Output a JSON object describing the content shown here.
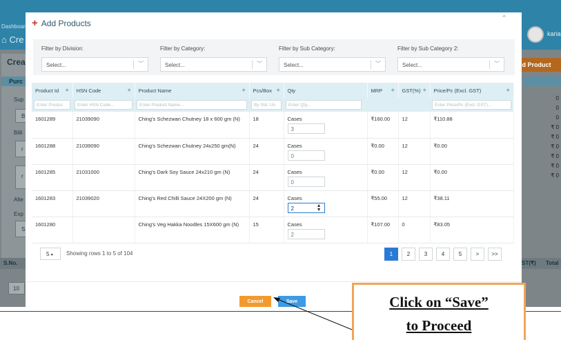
{
  "background": {
    "dashboard_label": "Dashboar",
    "create_heading": "Cre",
    "create_card_title": "Crea",
    "purchase_tab": "Purc",
    "user_name": "karia",
    "add_product_button": "ld Product",
    "side_labels": [
      "Sup",
      "B",
      "Billi",
      "r",
      "r",
      "Alte",
      "Exp",
      "S"
    ],
    "right_values": [
      "0",
      "0",
      "0",
      "₹ 0",
      "₹ 0",
      "₹ 0",
      "₹ 0",
      "₹ 0",
      "₹ 0"
    ],
    "footer_left": "S.No.",
    "footer_right_gst": "ST(₹)",
    "footer_right_total": "Total",
    "page_size_bg": "10"
  },
  "modal": {
    "title": "Add Products",
    "close_icon": "chevron-up-icon",
    "filters": [
      {
        "label": "Filter by Division:",
        "placeholder": "Select..."
      },
      {
        "label": "Filter by Category:",
        "placeholder": "Select..."
      },
      {
        "label": "Filter by Sub Category:",
        "placeholder": "Select..."
      },
      {
        "label": "Filter by Sub Category 2:",
        "placeholder": "Select..."
      }
    ],
    "table": {
      "columns": [
        "Product Id",
        "HSN Code",
        "Product Name",
        "Pcs/Box",
        "Qty",
        "MRP",
        "GST(%)",
        "Price/Pc (Excl. GST)"
      ],
      "filter_placeholders": [
        "Enter Produc",
        "Enter HSN Code...",
        "Enter Product Name...",
        "By Std. Un",
        "Enter Qty...",
        "",
        "",
        "Enter Price/Pc (Excl. GST)..."
      ],
      "rows": [
        {
          "id": "1601289",
          "hsn": "21039090",
          "name": "Ching's Schezwan Chutney 18 x 600 gm (N)",
          "pcs": "18",
          "unit": "Cases",
          "qty": "3",
          "mrp": "₹160.00",
          "gst": "12",
          "price": "₹110.88"
        },
        {
          "id": "1601288",
          "hsn": "21039090",
          "name": "Ching's Schezwan Chutney 24x250 gm(N)",
          "pcs": "24",
          "unit": "Cases",
          "qty": "0",
          "mrp": "₹0.00",
          "gst": "12",
          "price": "₹0.00"
        },
        {
          "id": "1601285",
          "hsn": "21031000",
          "name": "Ching's Dark Soy Sauce 24x210 gm (N)",
          "pcs": "24",
          "unit": "Cases",
          "qty": "0",
          "mrp": "₹0.00",
          "gst": "12",
          "price": "₹0.00"
        },
        {
          "id": "1601283",
          "hsn": "21039020",
          "name": "Ching's Red Chilli Sauce 24X200 gm (N)",
          "pcs": "24",
          "unit": "Cases",
          "qty": "2",
          "mrp": "₹55.00",
          "gst": "12",
          "price": "₹38.11"
        },
        {
          "id": "1601280",
          "hsn": "",
          "name": "Ching's Veg Hakka Noodles 15X600 gm (N)",
          "pcs": "15",
          "unit": "Cases",
          "qty": "2",
          "mrp": "₹107.00",
          "gst": "0",
          "price": "₹83.05"
        }
      ]
    },
    "pagination": {
      "page_size": "5",
      "showing_text": "Showing rows 1 to 5 of 104",
      "pages": [
        "1",
        "2",
        "3",
        "4",
        "5",
        ">",
        ">>"
      ],
      "active_page": "1"
    },
    "cancel_label": "Cancel",
    "save_label": "Save"
  },
  "callout": {
    "line1": "Click on “Save”",
    "line2": "to Proceed",
    "border_color": "#f0a656"
  }
}
